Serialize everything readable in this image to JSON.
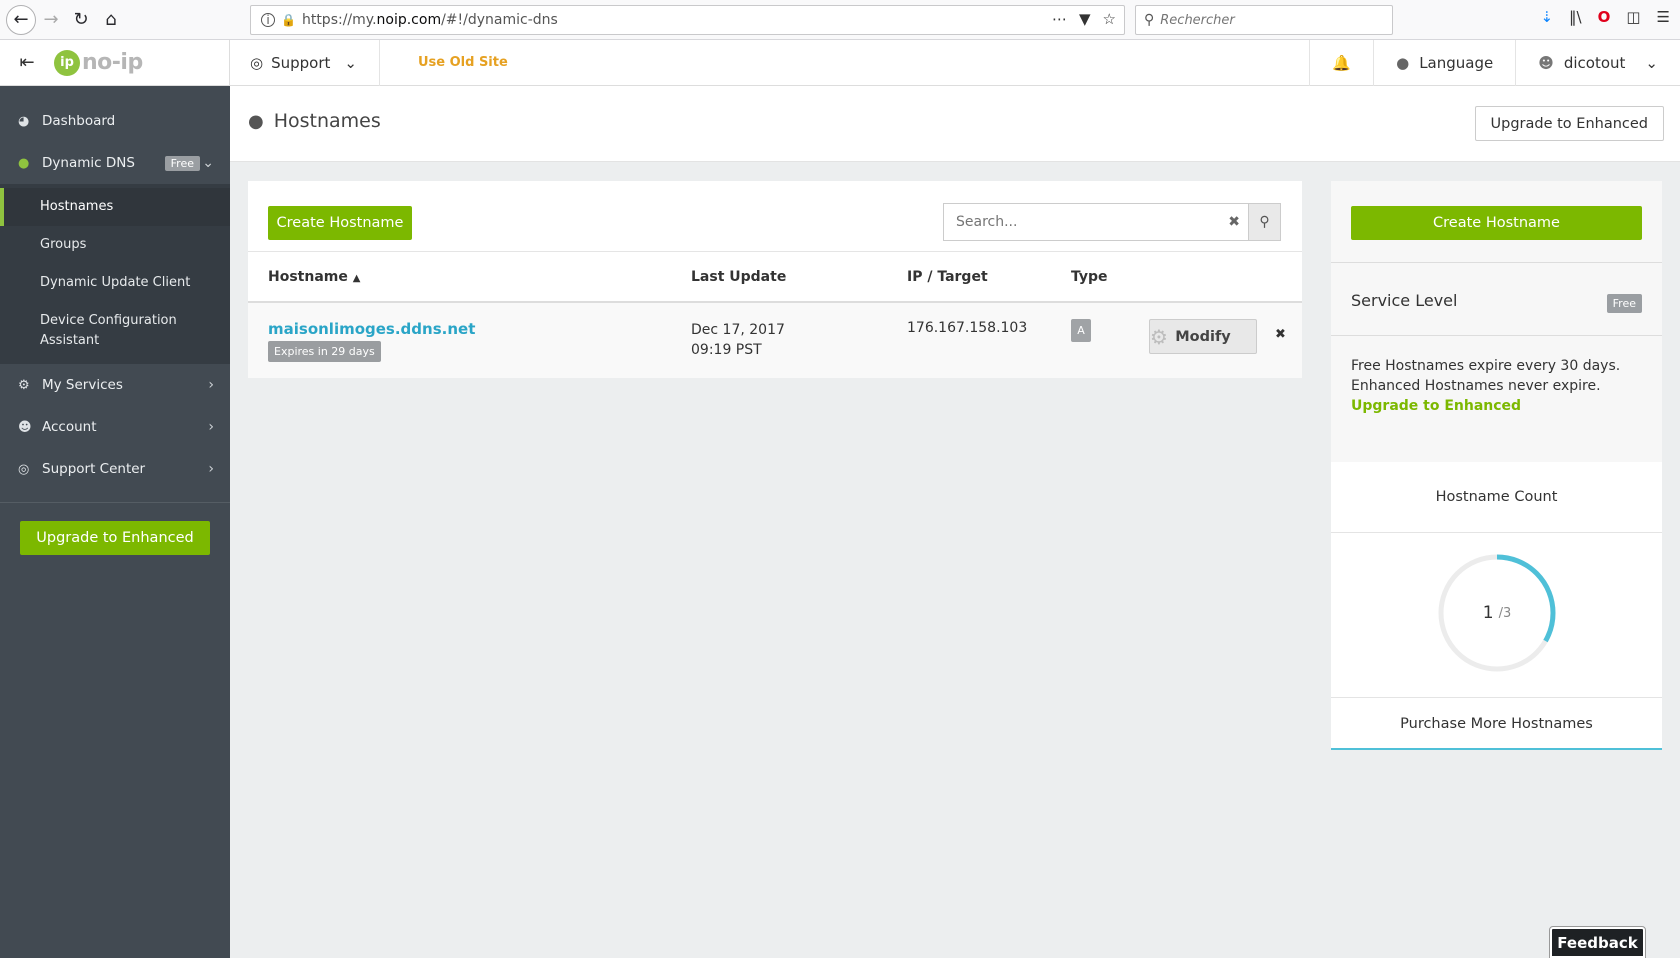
{
  "browser": {
    "url_prefix": "https://my.",
    "url_host": "noip.com",
    "url_path": "/#!/dynamic-dns",
    "search_placeholder": "Rechercher"
  },
  "sidebar": {
    "logo_mark": "ip",
    "logo_text": "no-ip",
    "items": [
      {
        "label": "Dashboard",
        "icon": "dashboard-icon"
      },
      {
        "label": "Dynamic DNS",
        "badge": "Free",
        "icon": "globe-icon"
      },
      {
        "label": "My Services",
        "icon": "gear-icon"
      },
      {
        "label": "Account",
        "icon": "user-icon"
      },
      {
        "label": "Support Center",
        "icon": "lifebuoy-icon"
      }
    ],
    "sub_items": [
      {
        "label": "Hostnames"
      },
      {
        "label": "Groups"
      },
      {
        "label": "Dynamic Update Client"
      },
      {
        "label": "Device Configuration Assistant"
      }
    ],
    "upgrade_label": "Upgrade to Enhanced"
  },
  "topnav": {
    "support_label": "Support",
    "use_old_label": "Use Old Site",
    "language_label": "Language",
    "user_label": "dicotout"
  },
  "header": {
    "title": "Hostnames",
    "upgrade_label": "Upgrade to Enhanced"
  },
  "main": {
    "create_label": "Create Hostname",
    "search_placeholder": "Search...",
    "columns": {
      "hostname": "Hostname",
      "last_update": "Last Update",
      "ip": "IP / Target",
      "type": "Type"
    },
    "rows": [
      {
        "hostname": "maisonlimoges.ddns.net",
        "expires": "Expires in 29 days",
        "last_update_date": "Dec 17, 2017",
        "last_update_time": "09:19 PST",
        "ip": "176.167.158.103",
        "type": "A",
        "modify_label": "Modify"
      }
    ]
  },
  "right": {
    "create_label": "Create Hostname",
    "service_level_label": "Service Level",
    "service_level_badge": "Free",
    "info_line1": "Free Hostnames expire every 30 days.",
    "info_line2": "Enhanced Hostnames never expire.",
    "info_link": "Upgrade to Enhanced",
    "count_title": "Hostname Count",
    "count_used": "1",
    "count_total": "/3",
    "count_fraction": 0.333,
    "purchase_label": "Purchase More Hostnames"
  },
  "feedback_label": "Feedback",
  "colors": {
    "accent_green": "#7cb800",
    "link_blue": "#2aa5c7",
    "ring_blue": "#4fc0d8",
    "sidebar_bg": "#424a52"
  }
}
